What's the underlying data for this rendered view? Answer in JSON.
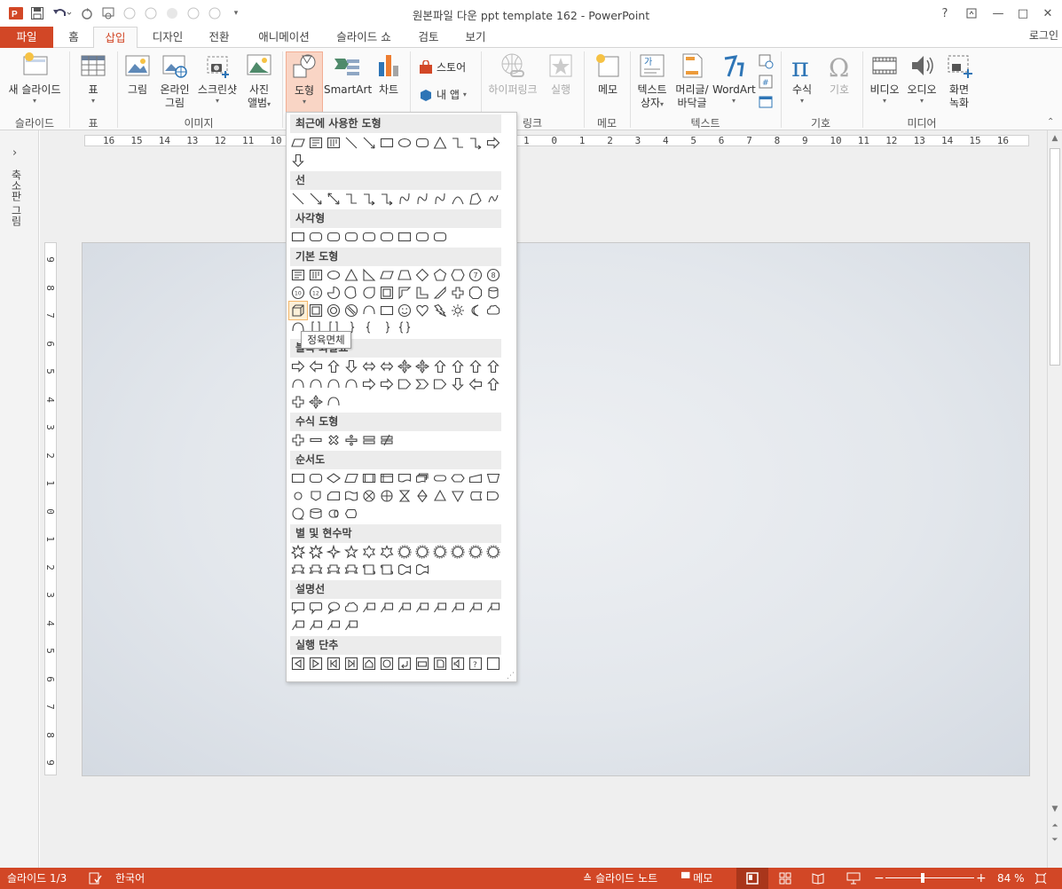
{
  "window": {
    "title": "원본파일 다운 ppt template 162 - PowerPoint",
    "help": "?",
    "controls": {
      "minimize": "—",
      "restore": "□",
      "close": "✕"
    }
  },
  "tabs": {
    "file": "파일",
    "items": [
      "홈",
      "삽입",
      "디자인",
      "전환",
      "애니메이션",
      "슬라이드 쇼",
      "검토",
      "보기"
    ],
    "active": "삽입",
    "login": "로그인"
  },
  "ribbon": {
    "slides": {
      "new_slide": "새 슬라이드",
      "group": "슬라이드"
    },
    "tables": {
      "table": "표",
      "group": "표"
    },
    "images": {
      "picture": "그림",
      "online_picture_1": "온라인",
      "online_picture_2": "그림",
      "screenshot": "스크린샷",
      "photo_album_1": "사진",
      "photo_album_2": "앨범",
      "group": "이미지"
    },
    "illustrations": {
      "shapes": "도형",
      "smartart": "SmartArt",
      "chart": "차트"
    },
    "apps": {
      "store": "스토어",
      "my_apps": "내 앱"
    },
    "links": {
      "hyperlink": "하이퍼링크",
      "action": "실행",
      "group": "링크"
    },
    "comments": {
      "comment": "메모",
      "group": "메모"
    },
    "text": {
      "textbox_1": "텍스트",
      "textbox_2": "상자",
      "header_1": "머리글/",
      "header_2": "바닥글",
      "wordart": "WordArt",
      "group": "텍스트"
    },
    "symbols": {
      "equation": "수식",
      "symbol": "기호",
      "group": "기호"
    },
    "media": {
      "video": "비디오",
      "audio": "오디오",
      "screen_rec_1": "화면",
      "screen_rec_2": "녹화",
      "group": "미디어"
    }
  },
  "leftpane": {
    "label": "축소판 그림"
  },
  "ruler": {
    "h_left": [
      "16",
      "15",
      "14",
      "13",
      "12",
      "11",
      "10"
    ],
    "h_right": [
      "1",
      "0",
      "1",
      "2",
      "3",
      "4",
      "5",
      "6",
      "7",
      "8",
      "9",
      "10",
      "11",
      "12",
      "13",
      "14",
      "15",
      "16"
    ],
    "v": [
      "9",
      "8",
      "7",
      "6",
      "5",
      "4",
      "3",
      "2",
      "1",
      "0",
      "1",
      "2",
      "3",
      "4",
      "5",
      "6",
      "7",
      "8",
      "9"
    ]
  },
  "gallery": {
    "sections": [
      {
        "title": "최근에 사용한 도형"
      },
      {
        "title": "선"
      },
      {
        "title": "사각형"
      },
      {
        "title": "기본 도형"
      },
      {
        "title": "블록 화살표"
      },
      {
        "title": "수식 도형"
      },
      {
        "title": "순서도"
      },
      {
        "title": "별 및 현수막"
      },
      {
        "title": "설명선"
      },
      {
        "title": "실행 단추"
      }
    ],
    "tooltip": "정육면체"
  },
  "status": {
    "slide": "슬라이드 1/3",
    "language": "한국어",
    "notes": "슬라이드 노트",
    "comments": "메모",
    "zoom": "84 %",
    "zoom_minus": "−",
    "zoom_plus": "+"
  },
  "colors": {
    "accent": "#d24726",
    "ribbon_bg": "#fafafa",
    "slide_bg": "#e3e7ec"
  }
}
